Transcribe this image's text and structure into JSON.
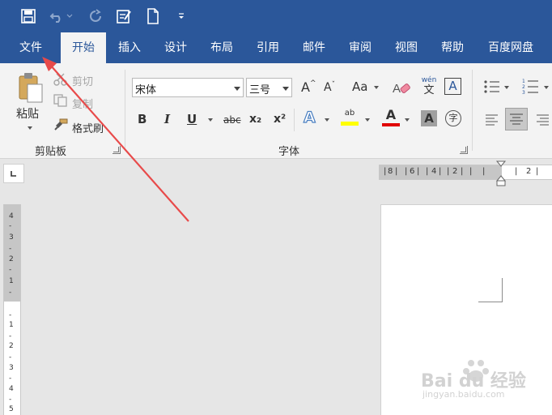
{
  "title_bar": {
    "icons": [
      "save-icon",
      "undo-icon",
      "redo-icon",
      "edit-icon",
      "new-document-icon",
      "customize-icon"
    ],
    "bg_color": "#2b579a"
  },
  "tabs": [
    {
      "label": "文件"
    },
    {
      "label": "开始",
      "active": true
    },
    {
      "label": "插入"
    },
    {
      "label": "设计"
    },
    {
      "label": "布局"
    },
    {
      "label": "引用"
    },
    {
      "label": "邮件"
    },
    {
      "label": "审阅"
    },
    {
      "label": "视图"
    },
    {
      "label": "帮助"
    },
    {
      "label": "百度网盘"
    }
  ],
  "clipboard": {
    "paste_label": "粘贴",
    "cut_label": "剪切",
    "copy_label": "复制",
    "format_painter_label": "格式刷",
    "group_label": "剪贴板"
  },
  "font": {
    "font_name": "宋体",
    "font_size": "三号",
    "case_label": "Aa",
    "phonetic_top": "wén",
    "phonetic_bottom": "文",
    "border_char": "A",
    "bold": "B",
    "italic": "I",
    "underline": "U",
    "strike": "abc",
    "subscript": "x₂",
    "superscript": "x²",
    "text_effects": "A",
    "highlight": "ab",
    "font_color": "A",
    "shading": "A",
    "enclose": "字",
    "group_label": "字体",
    "grow": "A",
    "shrink": "A"
  },
  "ruler": {
    "h_labels": [
      "8",
      "6",
      "4",
      "2",
      "2"
    ],
    "v_labels": [
      "4",
      "3",
      "2",
      "1",
      "1",
      "1",
      "2",
      "3",
      "4",
      "5"
    ]
  },
  "colors": {
    "accent": "#2b579a",
    "highlight": "#ffff00",
    "font_color": "#e00000",
    "arrow": "#e84a4a"
  },
  "watermark": {
    "brand": "Bai du 经验",
    "url": "jingyan.baidu.com"
  }
}
